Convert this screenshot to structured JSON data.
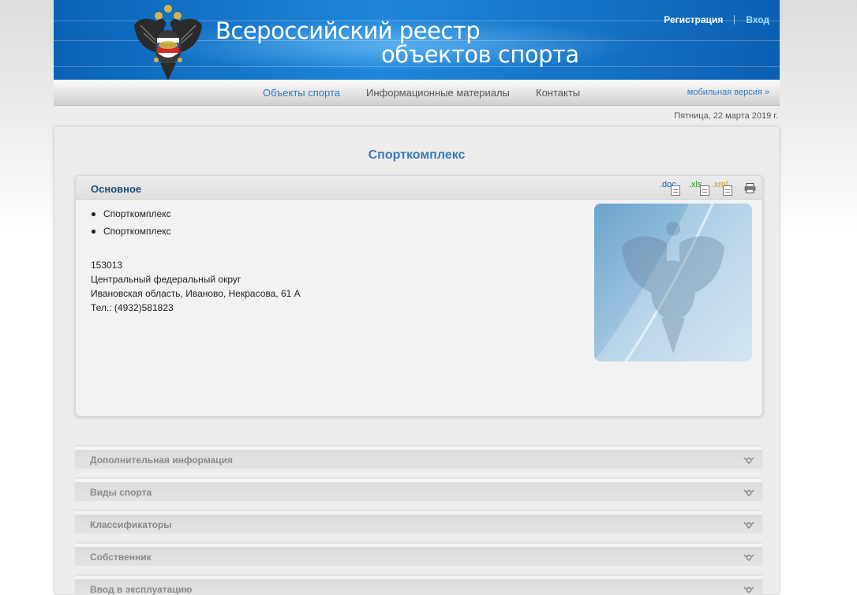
{
  "header": {
    "title_line1": "Всероссийский  реестр",
    "title_line2": "объектов спорта",
    "register_link": "Регистрация",
    "login_link": "Вход"
  },
  "nav": {
    "items": [
      {
        "label": "Объекты спорта",
        "active": true
      },
      {
        "label": "Информационные материалы",
        "active": false
      },
      {
        "label": "Контакты",
        "active": false
      }
    ],
    "mobile_link": "мобильная версия »"
  },
  "date": "Пятница, 22 марта 2019 г.",
  "page_title": "Спорткомплекс",
  "main_panel": {
    "title": "Основное",
    "exports": [
      {
        "label": ".doc",
        "color": "#1c5fa8"
      },
      {
        "label": ".xls",
        "color": "#2e8b2e"
      },
      {
        "label": ".xml",
        "color": "#d49a00"
      }
    ],
    "print_icon": "printer-icon",
    "bullets": [
      "Спорткомплекс",
      "Спорткомплекс"
    ],
    "address": {
      "postal_code": "153013",
      "district": "Центральный федеральный округ",
      "street": "Ивановская область, Иваново, Некрасова, 61 А",
      "phone": "Тел.: (4932)581823"
    }
  },
  "sections": [
    "Дополнительная информация",
    "Виды спорта",
    "Классификаторы",
    "Собственник",
    "Ввод в эксплуатацию"
  ],
  "colors": {
    "header_blue": "#0a62b6",
    "link_blue": "#2a7ac4",
    "title_blue": "#3a78b8"
  }
}
